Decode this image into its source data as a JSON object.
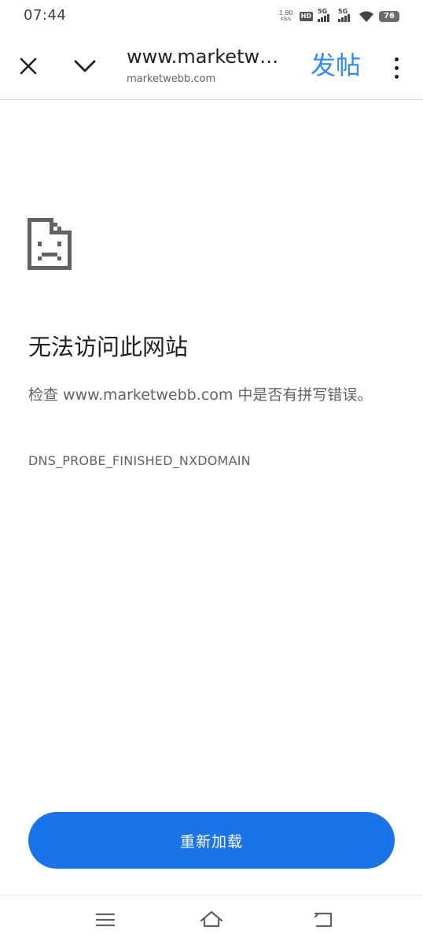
{
  "status_bar": {
    "time": "07:44",
    "net_speed_value": "1.80",
    "net_speed_unit": "KB/s",
    "hd_label": "HD",
    "sim1_label": "5G",
    "sim2_label": "5G",
    "battery": "76"
  },
  "toolbar": {
    "url_title": "www.marketw…",
    "url_domain": "marketwebb.com",
    "post_label": "发帖",
    "close_icon": "close-icon",
    "chevron_icon": "chevron-down-icon",
    "menu_icon": "more-vertical-icon"
  },
  "error": {
    "icon": "sad-page-icon",
    "title": "无法访问此网站",
    "description": "检查 www.marketwebb.com 中是否有拼写错误。",
    "code": "DNS_PROBE_FINISHED_NXDOMAIN"
  },
  "reload_label": "重新加载",
  "colors": {
    "accent": "#1a73e8",
    "post_text": "#2f8df2"
  },
  "nav_bar": {
    "menu_icon": "hamburger-icon",
    "home_icon": "home-icon",
    "back_icon": "back-icon"
  }
}
